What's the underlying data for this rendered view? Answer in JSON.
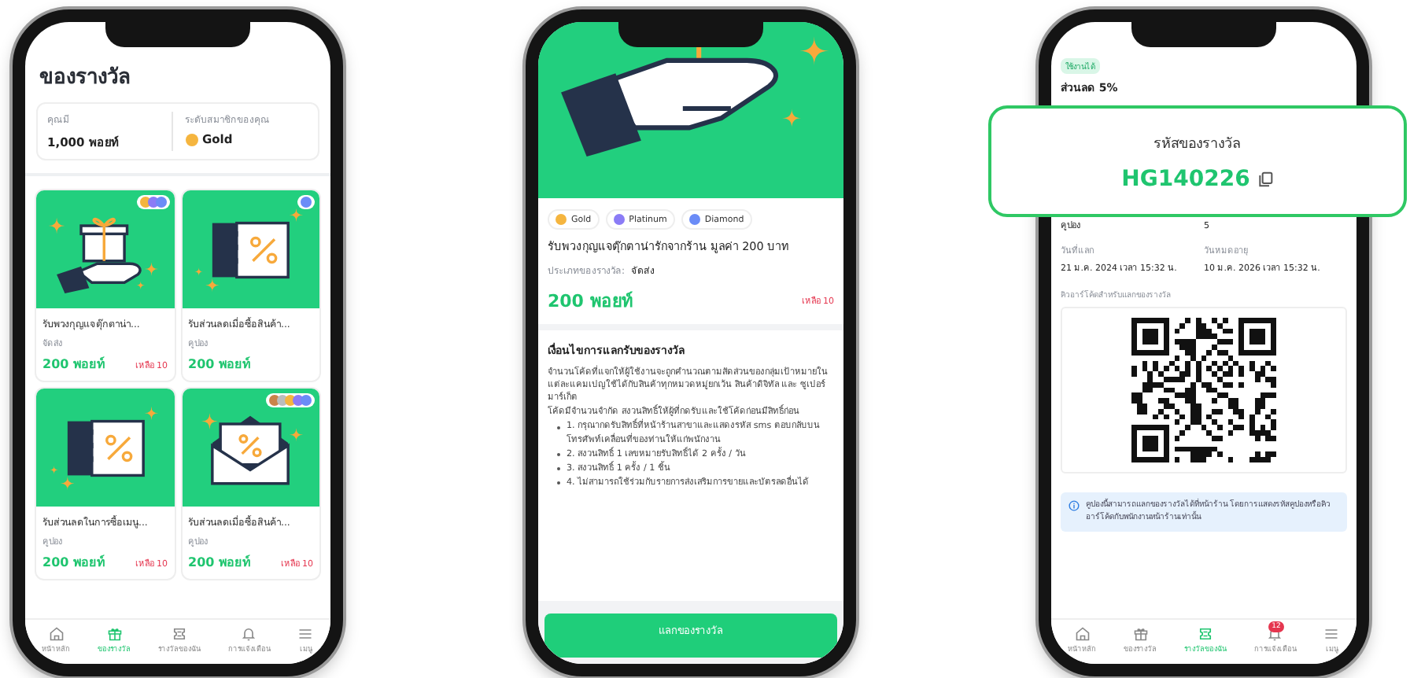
{
  "rewards_screen": {
    "title": "ของรางวัล",
    "balance": {
      "label": "คุณมี",
      "value": "1,000 พอยท์"
    },
    "tier": {
      "label": "ระดับสมาชิกของคุณ",
      "value": "Gold",
      "color": "#f5b53f"
    },
    "cards": [
      {
        "kind": "gift",
        "tiers": [
          {
            "color": "#f5b53f"
          },
          {
            "color": "#8b7cf6"
          },
          {
            "color": "#6b8cf7"
          }
        ],
        "title": "รับพวงกุญแจตุ๊กตาน่า...",
        "type": "จัดส่ง",
        "points": "200 พอยท์",
        "remaining": "เหลือ 10"
      },
      {
        "kind": "ticket",
        "tiers": [
          {
            "color": "#6b8cf7"
          }
        ],
        "title": "รับส่วนลดเมื่อซื้อสินค้า...",
        "type": "คูปอง",
        "points": "200 พอยท์"
      },
      {
        "kind": "ticket",
        "title": "รับส่วนลดในการซื้อเมนู...",
        "type": "คูปอง",
        "points": "200 พอยท์",
        "remaining": "เหลือ 10"
      },
      {
        "kind": "envelope",
        "tiers": [
          {
            "color": "#c9834a"
          },
          {
            "color": "#bdbdbd"
          },
          {
            "color": "#f5b53f"
          },
          {
            "color": "#8b7cf6"
          },
          {
            "color": "#6b8cf7"
          }
        ],
        "title": "รับส่วนลดเมื่อซื้อสินค้า...",
        "type": "คูปอง",
        "points": "200 พอยท์",
        "remaining": "เหลือ 10"
      }
    ],
    "nav": [
      {
        "label": "หน้าหลัก",
        "selected": false
      },
      {
        "label": "ของรางวัล",
        "selected": true
      },
      {
        "label": "รางวัลของฉัน",
        "selected": false
      },
      {
        "label": "การแจ้งเตือน",
        "selected": false
      },
      {
        "label": "เมนู",
        "selected": false
      }
    ]
  },
  "reward_detail_screen": {
    "tiers": [
      {
        "label": "Gold",
        "color": "#f5b53f"
      },
      {
        "label": "Platinum",
        "color": "#8b7cf6"
      },
      {
        "label": "Diamond",
        "color": "#6b8cf7"
      }
    ],
    "title": "รับพวงกุญแจตุ๊กตาน่ารักจากร้าน มูลค่า 200 บาท",
    "type_label": "ประเภทของรางวัล:",
    "type_value": "จัดส่ง",
    "points": "200 พอยท์",
    "remaining": "เหลือ 10",
    "conditions": {
      "heading": "เงื่อนไขการแลกรับของรางวัล",
      "paragraphs": [
        "จำนวนโค้ดที่แจกให้ผู้ใช้งานจะถูกคำนวณตามสัดส่วนของกลุ่มเป้าหมายในแต่ละแคมเปญใช้ได้กับสินค้าทุกหมวดหมู่ยกเว้น สินค้าดิจิทัล และ ซูเปอร์มาร์เก็ต",
        "โค้ดมีจำนวนจำกัด สงวนสิทธิ์ให้ผู้ที่กดรับและใช้โค้ดก่อนมีสิทธิ์ก่อน"
      ],
      "items": [
        "1. กรุณากดรับสิทธิ์ที่หน้าร้านสาขาและแสดงรหัส sms ตอบกลับบน โทรศัพท์เคลื่อนที่ของท่านให้แก่พนักงาน",
        "2. สงวนสิทธิ์ 1 เลขหมายรับสิทธิ์ได้ 2 ครั้ง / วัน",
        "3. สงวนสิทธิ์ 1 ครั้ง / 1 ชิ้น",
        "4. ไม่สามารถใช้ร่วมกับรายการส่งเสริมการขายและบัตรลดอื่นได้"
      ]
    },
    "button": "แลกของรางวัล"
  },
  "my_reward_screen": {
    "status": "ใช้งานได้",
    "title": "ส่วนลด 5%",
    "fields": [
      {
        "value": "คูปอง"
      },
      {
        "value": "5"
      },
      {
        "label": "วันที่แลก",
        "value": "21 ม.ค. 2024 เวลา 15:32 น."
      },
      {
        "label": "วันหมดอายุ",
        "value": "10 ม.ค. 2026 เวลา 15:32 น."
      }
    ],
    "qr_label": "คิวอาร์โค้ดสำหรับแลกของรางวัล",
    "info": "คูปองนี้สามารถแลกของรางวัลได้ที่หน้าร้าน โดยการแสดงรหัสคูปองหรือคิวอาร์โค้ดกับพนักงานหน้าร้านเท่านั้น",
    "nav": [
      {
        "label": "หน้าหลัก",
        "selected": false
      },
      {
        "label": "ของรางวัล",
        "selected": false
      },
      {
        "label": "รางวัลของฉัน",
        "selected": true
      },
      {
        "label": "การแจ้งเตือน",
        "selected": false,
        "badge": "12"
      },
      {
        "label": "เมนู",
        "selected": false
      }
    ]
  },
  "code_popup": {
    "label": "รหัสของรางวัล",
    "code": "HG140226"
  }
}
